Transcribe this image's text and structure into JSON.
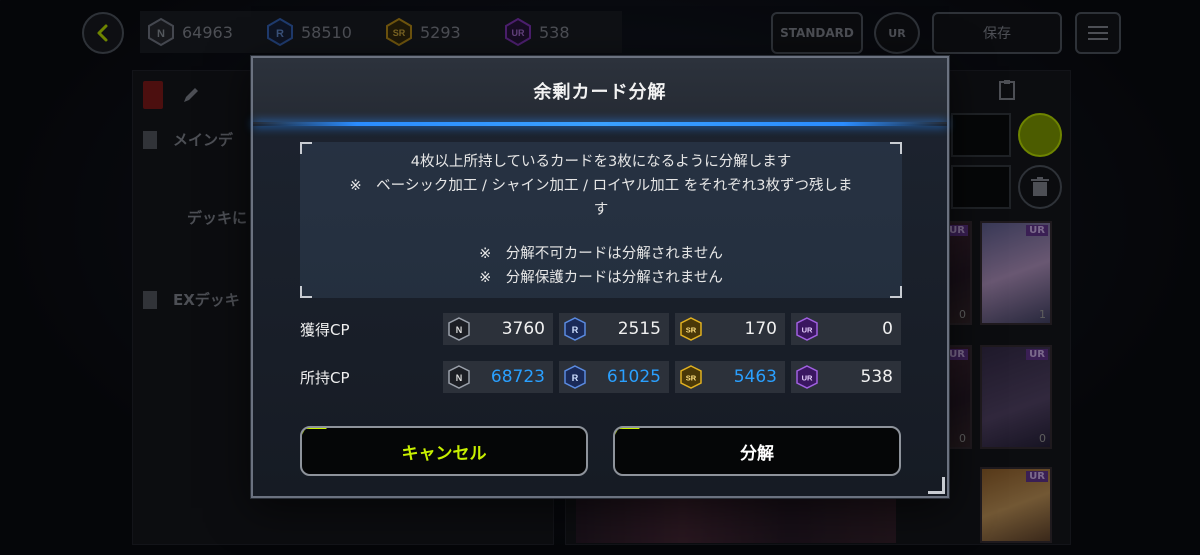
{
  "topbar": {
    "currencies": [
      {
        "rarity": "N",
        "amount": "64963",
        "color": "#7d8290"
      },
      {
        "rarity": "R",
        "amount": "58510",
        "color": "#3a6cc8"
      },
      {
        "rarity": "SR",
        "amount": "5293",
        "color": "#c89a1a"
      },
      {
        "rarity": "UR",
        "amount": "538",
        "color": "#8a3ac8"
      }
    ],
    "standard_label": "STANDARD",
    "ur_label": "UR",
    "save_label": "保存"
  },
  "left_panel": {
    "main_deck_label": "メインデ",
    "deck_hint": "デッキに",
    "ex_deck_label": "EXデッキ"
  },
  "right_panel": {
    "cards": [
      {
        "rarity": "UR",
        "count": "0"
      },
      {
        "rarity": "UR",
        "count": "1"
      },
      {
        "rarity": "UR",
        "count": "0"
      },
      {
        "rarity": "UR",
        "count": "0"
      },
      {
        "rarity": "UR",
        "count": ""
      }
    ]
  },
  "modal": {
    "title": "余剰カード分解",
    "info": {
      "line1": "4枚以上所持しているカードを3枚になるように分解します",
      "line2": "※　ベーシック加工 / シャイン加工 / ロイヤル加工 をそれぞれ3枚ずつ残しま",
      "line3": "す",
      "note1": "※　分解不可カードは分解されません",
      "note2": "※　分解保護カードは分解されません"
    },
    "gain_row": {
      "label": "獲得CP",
      "values": [
        "3760",
        "2515",
        "170",
        "0"
      ]
    },
    "owned_row": {
      "label": "所持CP",
      "values": [
        "68723",
        "61025",
        "5463",
        "538"
      ]
    },
    "rarity_labels": [
      "N",
      "R",
      "SR",
      "UR"
    ],
    "cancel_label": "キャンセル",
    "confirm_label": "分解"
  },
  "colors": {
    "accent_lime": "#c8f000",
    "accent_blue": "#2aa0ff",
    "gem_n": "#7d8290",
    "gem_r": "#3a6cc8",
    "gem_sr": "#c89a1a",
    "gem_ur": "#8a3ac8"
  }
}
